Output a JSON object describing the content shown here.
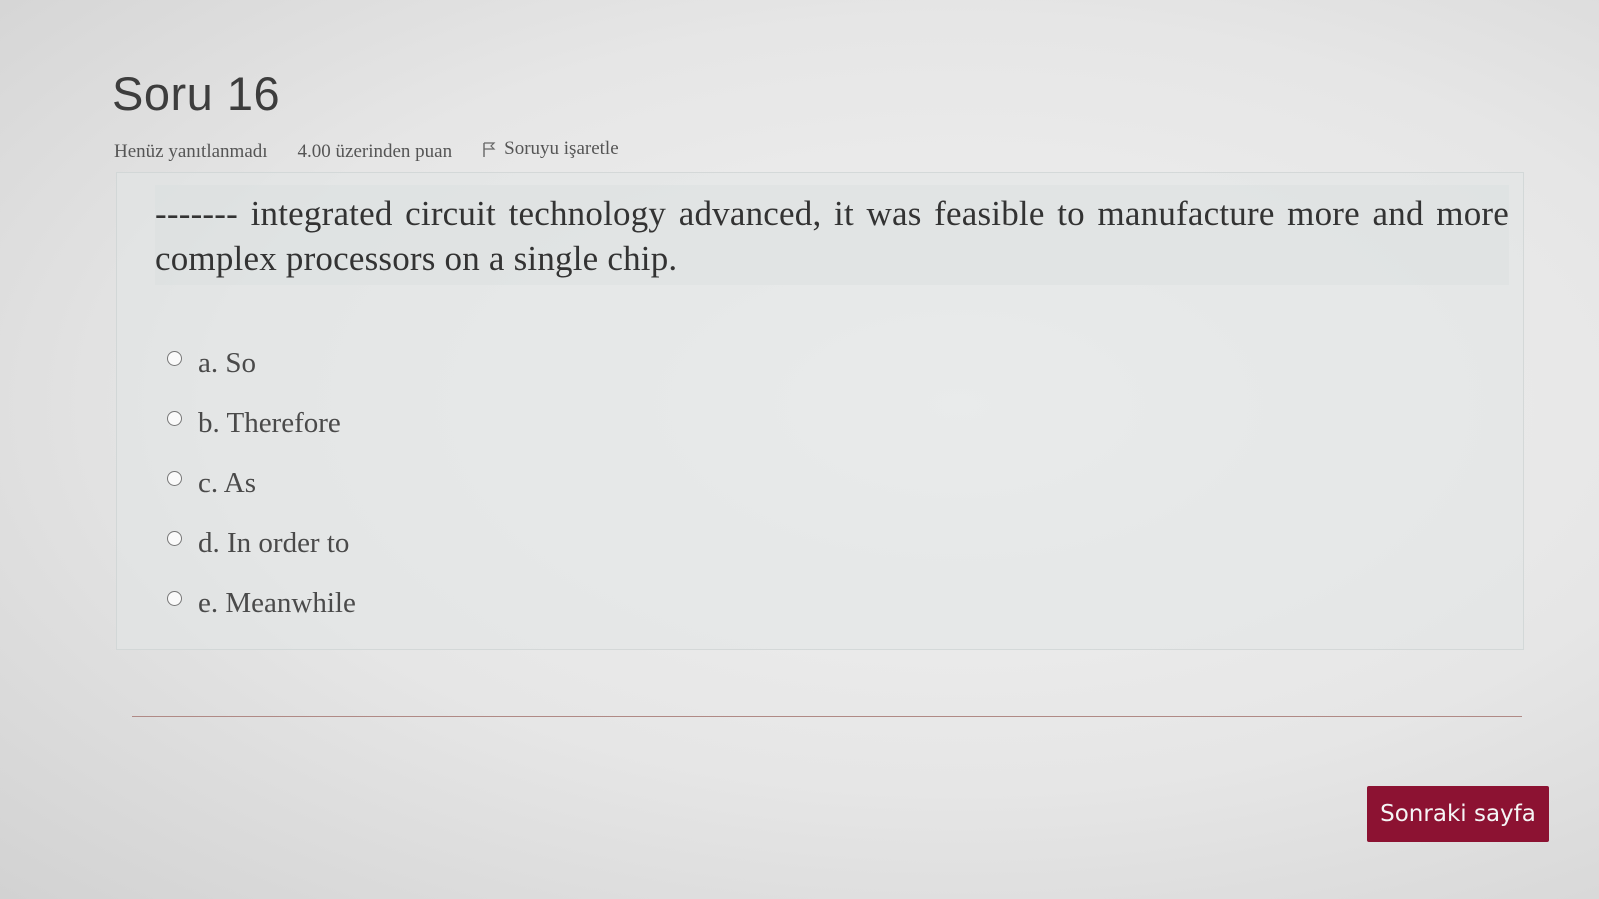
{
  "question": {
    "title": "Soru 16",
    "state": "Henüz yanıtlanmadı",
    "grade": "4.00 üzerinden puan",
    "flag_label": "Soruyu işaretle",
    "text": "------- integrated circuit technology advanced, it was feasible to manufacture more and more complex processors on a single chip.",
    "answers": [
      {
        "label": "a. So"
      },
      {
        "label": "b. Therefore"
      },
      {
        "label": "c. As"
      },
      {
        "label": "d. In order to"
      },
      {
        "label": "e. Meanwhile"
      }
    ]
  },
  "navigation": {
    "next_label": "Sonraki sayfa"
  },
  "icons": {
    "flag": "flag-icon",
    "radio": "radio-icon"
  },
  "colors": {
    "button_background": "#8c1232",
    "divider": "#b08a86"
  }
}
